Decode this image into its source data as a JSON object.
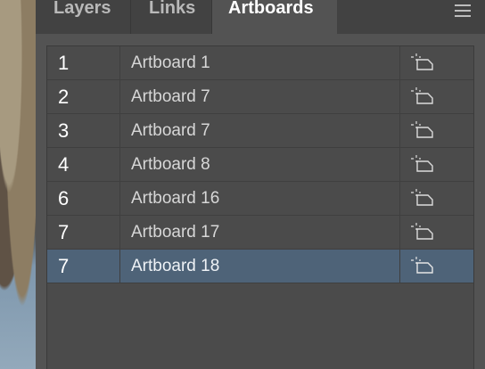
{
  "tabs": [
    {
      "label": "Layers"
    },
    {
      "label": "Links"
    },
    {
      "label": "Artboards"
    }
  ],
  "panel_menu_icon": "hamburger-menu-icon",
  "artboards": [
    {
      "number": "1",
      "name": "Artboard 1",
      "icon": "artboard-options-icon",
      "selected": false
    },
    {
      "number": "2",
      "name": "Artboard 7",
      "icon": "artboard-options-icon",
      "selected": false
    },
    {
      "number": "3",
      "name": "Artboard 7",
      "icon": "artboard-options-icon",
      "selected": false
    },
    {
      "number": "4",
      "name": "Artboard 8",
      "icon": "artboard-options-icon",
      "selected": false
    },
    {
      "number": "6",
      "name": "Artboard 16",
      "icon": "artboard-options-icon",
      "selected": false
    },
    {
      "number": "7",
      "name": "Artboard 17",
      "icon": "artboard-options-icon",
      "selected": false
    },
    {
      "number": "7",
      "name": "Artboard 18",
      "icon": "artboard-options-icon",
      "selected": true
    }
  ],
  "colors": {
    "panel_bg": "#535353",
    "tabbar_bg": "#424242",
    "selected_row": "#4e6378",
    "text": "#d7d7d7"
  }
}
